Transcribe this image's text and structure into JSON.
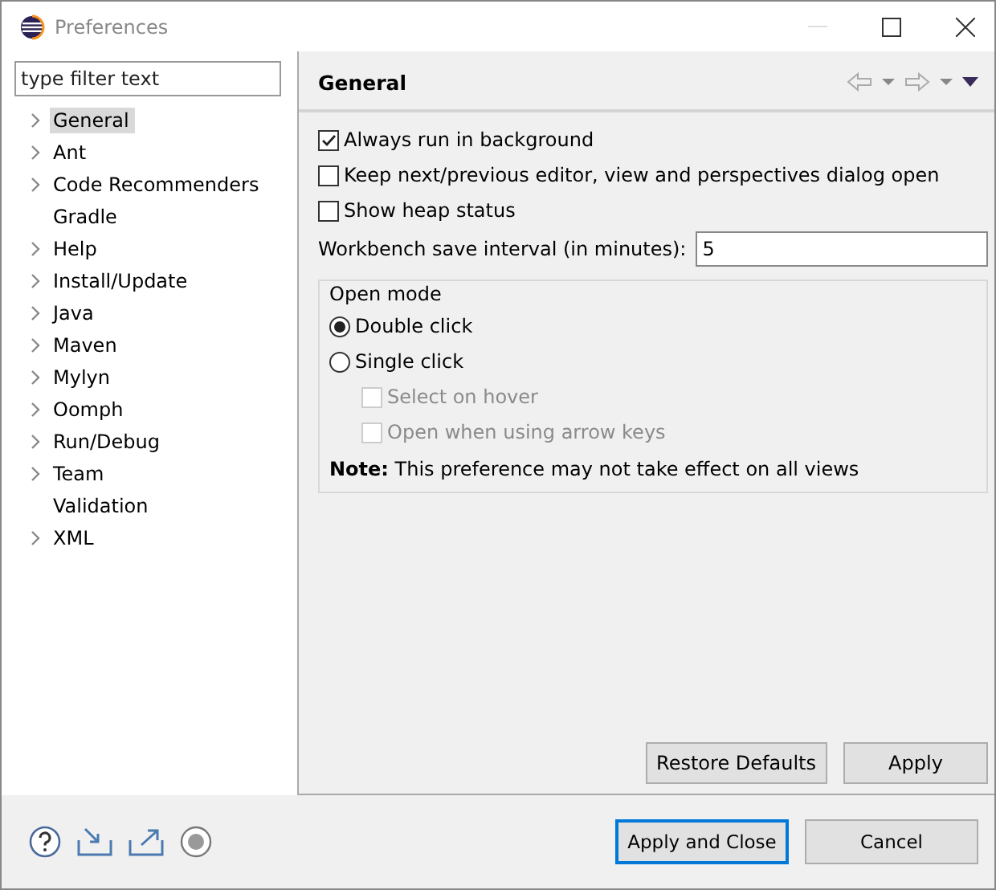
{
  "window": {
    "title": "Preferences"
  },
  "filter": {
    "placeholder": "type filter text"
  },
  "tree": [
    {
      "label": "General",
      "expandable": true,
      "selected": true
    },
    {
      "label": "Ant",
      "expandable": true,
      "selected": false
    },
    {
      "label": "Code Recommenders",
      "expandable": true,
      "selected": false
    },
    {
      "label": "Gradle",
      "expandable": false,
      "selected": false
    },
    {
      "label": "Help",
      "expandable": true,
      "selected": false
    },
    {
      "label": "Install/Update",
      "expandable": true,
      "selected": false
    },
    {
      "label": "Java",
      "expandable": true,
      "selected": false
    },
    {
      "label": "Maven",
      "expandable": true,
      "selected": false
    },
    {
      "label": "Mylyn",
      "expandable": true,
      "selected": false
    },
    {
      "label": "Oomph",
      "expandable": true,
      "selected": false
    },
    {
      "label": "Run/Debug",
      "expandable": true,
      "selected": false
    },
    {
      "label": "Team",
      "expandable": true,
      "selected": false
    },
    {
      "label": "Validation",
      "expandable": false,
      "selected": false
    },
    {
      "label": "XML",
      "expandable": true,
      "selected": false
    }
  ],
  "page": {
    "title": "General",
    "options": [
      {
        "label": "Always run in background",
        "checked": true
      },
      {
        "label": "Keep next/previous editor, view and perspectives dialog open",
        "checked": false
      },
      {
        "label": "Show heap status",
        "checked": false
      }
    ],
    "save_interval": {
      "label": "Workbench save interval (in minutes):",
      "value": "5"
    },
    "open_mode": {
      "title": "Open mode",
      "radios": [
        {
          "label": "Double click",
          "selected": true
        },
        {
          "label": "Single click",
          "selected": false
        }
      ],
      "sub_options": [
        {
          "label": "Select on hover",
          "checked": false,
          "disabled": true
        },
        {
          "label": "Open when using arrow keys",
          "checked": false,
          "disabled": true
        }
      ],
      "note": "**Note:** This preference may not take effect on all views"
    },
    "buttons": [
      "Restore Defaults",
      "Apply"
    ]
  },
  "footer_buttons": [
    {
      "label": "Apply and Close",
      "default": true
    },
    {
      "label": "Cancel",
      "default": false
    }
  ]
}
